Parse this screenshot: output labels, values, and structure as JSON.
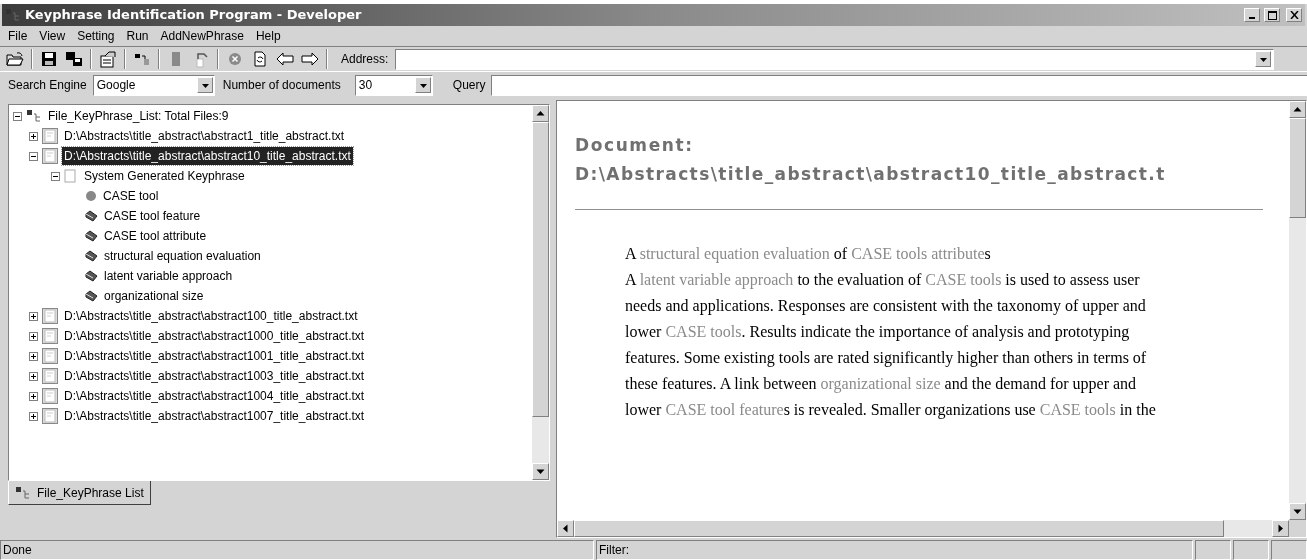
{
  "window": {
    "title": "Keyphrase Identification Program - Developer"
  },
  "menu": [
    "File",
    "View",
    "Setting",
    "Run",
    "AddNewPhrase",
    "Help"
  ],
  "toolbar": [
    {
      "kind": "open",
      "disabled": false
    },
    {
      "kind": "sep"
    },
    {
      "kind": "save",
      "disabled": false
    },
    {
      "kind": "saveall",
      "disabled": false
    },
    {
      "kind": "sep"
    },
    {
      "kind": "props",
      "disabled": false
    },
    {
      "kind": "sep"
    },
    {
      "kind": "tree",
      "disabled": false
    },
    {
      "kind": "sep"
    },
    {
      "kind": "stop",
      "disabled": true
    },
    {
      "kind": "undo",
      "disabled": true
    },
    {
      "kind": "sep"
    },
    {
      "kind": "cancel",
      "disabled": true
    },
    {
      "kind": "refresh",
      "disabled": false
    },
    {
      "kind": "back",
      "disabled": false
    },
    {
      "kind": "forward",
      "disabled": false
    },
    {
      "kind": "sep"
    }
  ],
  "address": {
    "label": "Address:"
  },
  "search": {
    "engine_label": "Search Engine",
    "engine": "Google",
    "count_label": "Number of documents",
    "count": "30",
    "query_label": "Query"
  },
  "tree": {
    "label": "File_KeyPhrase_List: Total Files:9",
    "expanded": true,
    "children": [
      {
        "label": "D:\\Abstracts\\title_abstract\\abstract1_title_abstract.txt",
        "expanded": false,
        "selected": false
      },
      {
        "label": "D:\\Abstracts\\title_abstract\\abstract10_title_abstract.txt",
        "expanded": true,
        "selected": true,
        "children": [
          {
            "label": "System Generated Keyphrase",
            "expanded": true,
            "children": [
              {
                "label": "CASE tool",
                "kind": "dot"
              },
              {
                "label": "CASE tool feature",
                "kind": "tag"
              },
              {
                "label": "CASE tool attribute",
                "kind": "tag"
              },
              {
                "label": "structural equation evaluation",
                "kind": "tag"
              },
              {
                "label": "latent variable approach",
                "kind": "tag"
              },
              {
                "label": "organizational size",
                "kind": "tag"
              }
            ]
          }
        ]
      },
      {
        "label": "D:\\Abstracts\\title_abstract\\abstract100_title_abstract.txt",
        "expanded": false,
        "selected": false
      },
      {
        "label": "D:\\Abstracts\\title_abstract\\abstract1000_title_abstract.txt",
        "expanded": false,
        "selected": false
      },
      {
        "label": "D:\\Abstracts\\title_abstract\\abstract1001_title_abstract.txt",
        "expanded": false,
        "selected": false
      },
      {
        "label": "D:\\Abstracts\\title_abstract\\abstract1003_title_abstract.txt",
        "expanded": false,
        "selected": false
      },
      {
        "label": "D:\\Abstracts\\title_abstract\\abstract1004_title_abstract.txt",
        "expanded": false,
        "selected": false
      },
      {
        "label": "D:\\Abstracts\\title_abstract\\abstract1007_title_abstract.txt",
        "expanded": false,
        "selected": false
      }
    ]
  },
  "tab": {
    "label": "File_KeyPhrase List",
    "selected": true
  },
  "document": {
    "heading": "Document:",
    "path": "D:\\Abstracts\\title_abstract\\abstract10_title_abstract.t",
    "title": [
      {
        "text": "A ",
        "highlight": false
      },
      {
        "text": "structural equation evaluation",
        "highlight": true
      },
      {
        "text": " of ",
        "highlight": false
      },
      {
        "text": "CASE tools attribute",
        "highlight": true
      },
      {
        "text": "s",
        "highlight": false
      }
    ],
    "body": [
      {
        "text": "A ",
        "highlight": false
      },
      {
        "text": "latent variable approach",
        "highlight": true
      },
      {
        "text": " to the evaluation of ",
        "highlight": false
      },
      {
        "text": "CASE tools",
        "highlight": true
      },
      {
        "text": " is used to assess user needs and applications. Responses are consistent with the taxonomy of upper and lower ",
        "highlight": false
      },
      {
        "text": "CASE tools",
        "highlight": true
      },
      {
        "text": ". Results indicate the importance of analysis and prototyping features. Some existing tools are rated significantly higher than others in terms of these features. A link between ",
        "highlight": false
      },
      {
        "text": "organizational size",
        "highlight": true
      },
      {
        "text": " and the demand for upper and lower ",
        "highlight": false
      },
      {
        "text": "CASE tool feature",
        "highlight": true
      },
      {
        "text": "s is revealed. Smaller organizations use ",
        "highlight": false
      },
      {
        "text": "CASE tools",
        "highlight": true
      },
      {
        "text": " in the",
        "highlight": false
      }
    ]
  },
  "status_bar": {
    "message": "Done",
    "filter": "Filter:"
  }
}
